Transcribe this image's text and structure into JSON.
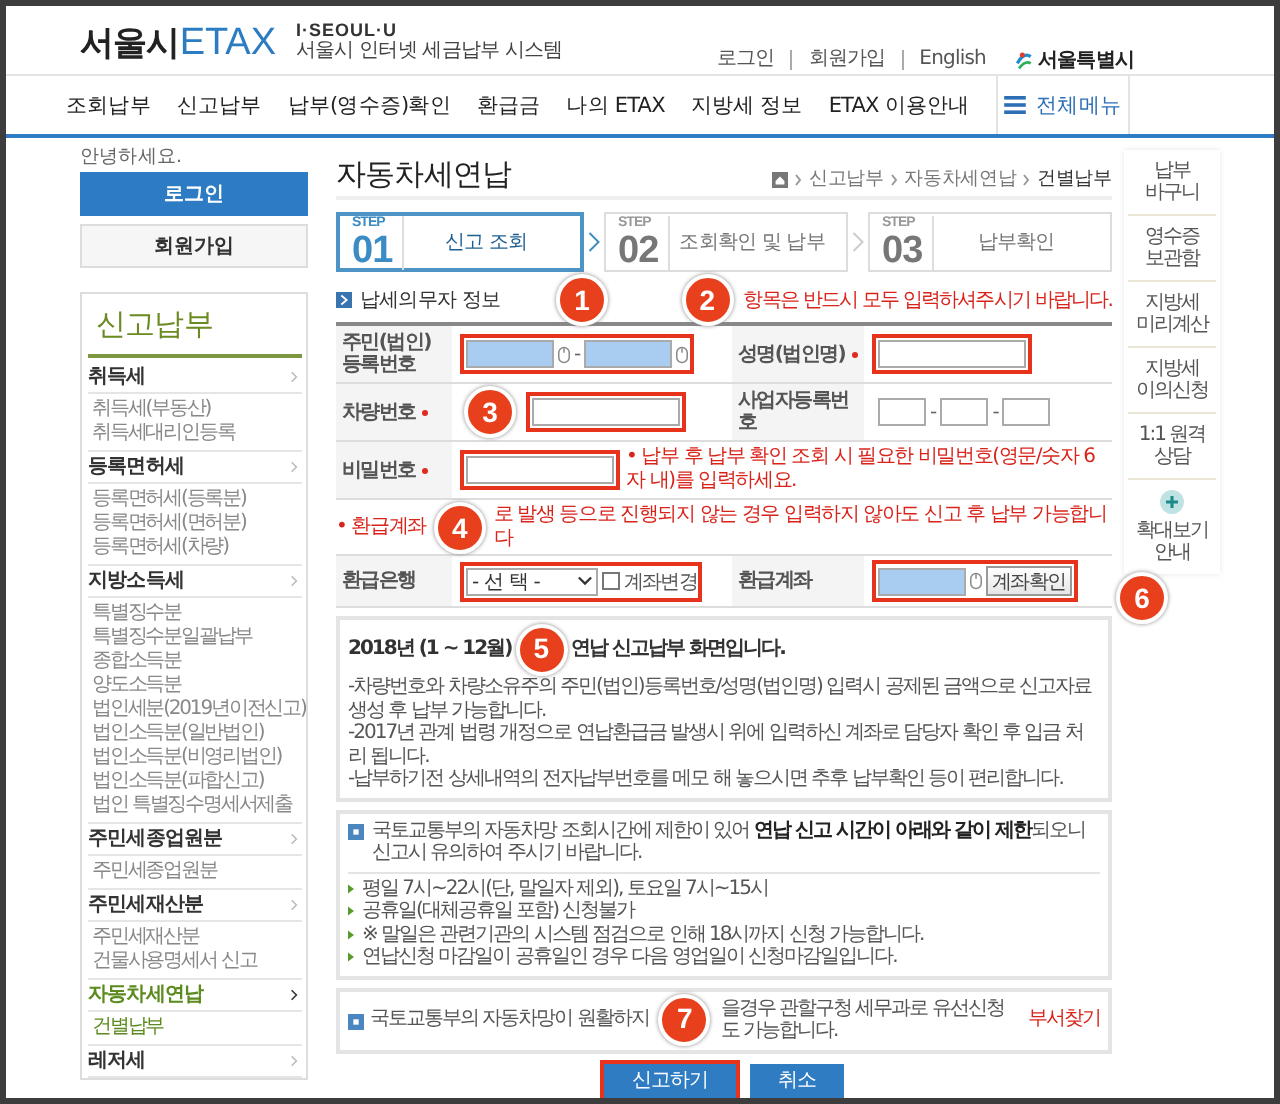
{
  "header": {
    "logo_city": "서울시",
    "logo_brand": "ETAX",
    "slogan": "I·SEOUL·U",
    "subtitle": "서울시 인터넷 세금납부 시스템",
    "links": [
      "로그인",
      "회원가입",
      "English"
    ],
    "city_logo": "서울특별시"
  },
  "nav": {
    "items": [
      "조회납부",
      "신고납부",
      "납부(영수증)확인",
      "환급금",
      "나의 ETAX",
      "지방세 정보",
      "ETAX 이용안내"
    ],
    "all_menu": "전체메뉴"
  },
  "account": {
    "greeting": "안녕하세요.",
    "login": "로그인",
    "join": "회원가입"
  },
  "sidebar": {
    "title": "신고납부",
    "groups": [
      {
        "label": "취득세",
        "selected": false,
        "children": [
          {
            "label": "취득세(부동산)",
            "selected": false
          },
          {
            "label": "취득세대리인등록",
            "selected": false
          }
        ]
      },
      {
        "label": "등록면허세",
        "selected": false,
        "children": [
          {
            "label": "등록면허세(등록분)",
            "selected": false
          },
          {
            "label": "등록면허세(면허분)",
            "selected": false
          },
          {
            "label": "등록면허세(차량)",
            "selected": false
          }
        ]
      },
      {
        "label": "지방소득세",
        "selected": false,
        "children": [
          {
            "label": "특별징수분",
            "selected": false
          },
          {
            "label": "특별징수분일괄납부",
            "selected": false
          },
          {
            "label": "종합소득분",
            "selected": false
          },
          {
            "label": "양도소득분",
            "selected": false
          },
          {
            "label": "법인세분(2019년이전신고)",
            "selected": false
          },
          {
            "label": "법인소득분(일반법인)",
            "selected": false
          },
          {
            "label": "법인소득분(비영리법인)",
            "selected": false
          },
          {
            "label": "법인소득분(파합신고)",
            "selected": false
          },
          {
            "label": "법인 특별징수명세서제출",
            "selected": false
          }
        ]
      },
      {
        "label": "주민세종업원분",
        "selected": false,
        "children": [
          {
            "label": "주민세종업원분",
            "selected": false
          }
        ]
      },
      {
        "label": "주민세재산분",
        "selected": false,
        "children": [
          {
            "label": "주민세재산분",
            "selected": false
          },
          {
            "label": "건물사용명세서 신고",
            "selected": false
          }
        ]
      },
      {
        "label": "자동차세연납",
        "selected": true,
        "children": [
          {
            "label": "건별납부",
            "selected": true
          }
        ]
      },
      {
        "label": "레저세",
        "selected": false
      }
    ]
  },
  "page": {
    "title": "자동차세연납",
    "breadcrumb": [
      "신고납부",
      "자동차세연납",
      "건별납부"
    ]
  },
  "steps": [
    {
      "step": "STEP",
      "number": "01",
      "label": "신고 조회",
      "selected": true
    },
    {
      "step": "STEP",
      "number": "02",
      "label": "조회확인 및 납부",
      "selected": false
    },
    {
      "step": "STEP",
      "number": "03",
      "label": "납부확인",
      "selected": false
    }
  ],
  "form": {
    "title": "납세의무자 정보",
    "title_callout": "1",
    "note_callout": "2",
    "required_note": "항목은 반드시 모두 입력하셔주시기 바랍니다.",
    "rows": [
      {
        "kind": "fields",
        "cells": [
          {
            "kind": "label",
            "lines": [
              "주민(법인)",
              "등록번호"
            ],
            "required": false
          },
          {
            "kind": "inputs",
            "highlighted": true,
            "separator": "-",
            "inputs": [
              {
                "kind": "secure"
              },
              {
                "kind": "secure"
              }
            ]
          },
          {
            "kind": "label",
            "lines": [
              "성명(법인명)"
            ],
            "required": true
          },
          {
            "kind": "inputs",
            "highlighted": true,
            "inputs": [
              {
                "kind": "text"
              }
            ]
          }
        ]
      },
      {
        "kind": "fields",
        "cells": [
          {
            "kind": "label",
            "lines": [
              "차량번호"
            ],
            "required": true
          },
          {
            "kind": "inputs",
            "highlighted": true,
            "callout": "3",
            "callout_inline": true,
            "inputs": [
              {
                "kind": "text"
              }
            ]
          },
          {
            "kind": "label",
            "lines": [
              "사업자등록번호"
            ],
            "required": false
          },
          {
            "kind": "inputs",
            "highlighted": false,
            "separator": "-",
            "inputs": [
              {
                "kind": "text"
              },
              {
                "kind": "text"
              },
              {
                "kind": "text"
              }
            ]
          }
        ]
      },
      {
        "kind": "fields",
        "cells": [
          {
            "kind": "label",
            "lines": [
              "비밀번호"
            ],
            "required": true
          },
          {
            "kind": "inputs",
            "wide": true,
            "highlighted": true,
            "inputs": [
              {
                "kind": "text"
              }
            ],
            "note": "• 납부 후 납부 확인 조회 시 필요한 비밀번호(영문/숫자 6자 내)를 입력하세요."
          }
        ]
      },
      {
        "kind": "note",
        "parts": [
          "• 환급계좌",
          "로 발생 등으로 진행되지 않는 경우 입력하지 않아도 신고 후 납부 가능합니다"
        ],
        "callout": "4"
      },
      {
        "kind": "fields",
        "cells": [
          {
            "kind": "label",
            "lines": [
              "환급은행"
            ],
            "required": false
          },
          {
            "kind": "inputs",
            "highlighted": true,
            "inputs": [
              {
                "kind": "select",
                "value": "- 선 택 -"
              },
              {
                "kind": "checkbox",
                "label": "계좌변경",
                "checked": false
              }
            ]
          },
          {
            "kind": "label",
            "lines": [
              "환급계좌"
            ],
            "required": false
          },
          {
            "kind": "inputs",
            "highlighted": true,
            "callout": "6",
            "callout_inline": false,
            "inputs": [
              {
                "kind": "secure"
              },
              {
                "kind": "button",
                "label": "계좌확인"
              }
            ]
          }
        ]
      }
    ]
  },
  "info_box": {
    "lines": [
      {
        "parts": [
          "2018년 (1 ~ 12월)",
          "연납 신고납부 화면입니다."
        ],
        "bold": true,
        "callout": "5"
      },
      {
        "parts": [
          "-차량번호와 차량소유주의 주민(법인)등록번호/성명(법인명) 입력시 공제된 금액으로 신고자료 생성 후 납부 가능합니다."
        ],
        "bold": false
      },
      {
        "parts": [
          "-2017년 관계 법령 개정으로 연납환급금 발생시 위에 입력하신 계좌로 담당자 확인 후 입금 처리 됩니다."
        ],
        "bold": false
      },
      {
        "parts": [
          "-납부하기전 상세내역의 전자납부번호를 메모 해 놓으시면 추후 납부확인 등이 편리합니다."
        ],
        "bold": false
      }
    ]
  },
  "notice_box": {
    "intro": "국토교통부의 자동차망 조회시간에 제한이 있어 **연납 신고 시간이 아래와 같이 제한**되오니 신고시 유의하여 주시기 바랍니다.",
    "bullets": [
      "평일 7시~22시(단, 말일자 제외), 토요일 7시~15시",
      "공휴일(대체공휴일 포함) 신청불가",
      "※ 말일은 관련기관의 시스템 점검으로 인해 18시까지 신청 가능합니다.",
      "연납신청 마감일이 공휴일인 경우 다음 영업일이 신청마감일입니다."
    ]
  },
  "contact_box": {
    "parts": [
      "국토교통부의 자동차망이 원활하지",
      "을경우 관할구청 세무과로 유선신청도 가능합니다."
    ],
    "callout": "7",
    "link": "부서찾기"
  },
  "buttons": [
    {
      "label": "신고하기",
      "highlighted": true
    },
    {
      "label": "취소",
      "highlighted": false
    }
  ],
  "quick_menu": [
    {
      "lines": [
        "납부",
        "바구니"
      ],
      "kind": "text"
    },
    {
      "lines": [
        "영수증",
        "보관함"
      ],
      "kind": "text"
    },
    {
      "lines": [
        "지방세",
        "미리계산"
      ],
      "kind": "text"
    },
    {
      "lines": [
        "지방세",
        "이의신청"
      ],
      "kind": "text"
    },
    {
      "lines": [
        "1:1 원격",
        "상담"
      ],
      "kind": "text"
    },
    {
      "lines": [
        "확대보기",
        "안내"
      ],
      "kind": "zoom"
    }
  ]
}
